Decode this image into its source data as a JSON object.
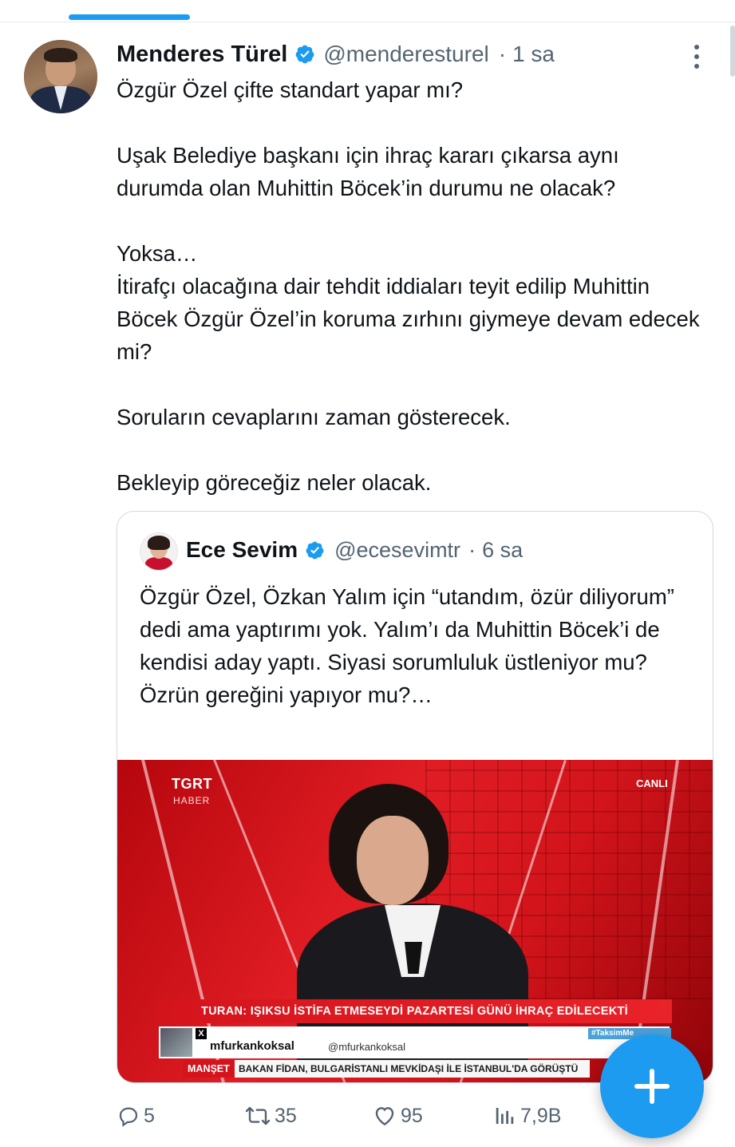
{
  "tweet": {
    "author_name": "Menderes Türel",
    "handle": "@menderesturel",
    "time": "1 sa",
    "paragraphs": [
      "Özgür Özel çifte standart yapar mı?",
      "Uşak Belediye başkanı için ihraç kararı çıkarsa aynı durumda olan Muhittin Böcek’in durumu ne olacak?",
      "Yoksa…\nİtirafçı olacağına dair tehdit iddiaları teyit edilip Muhittin Böcek Özgür Özel’in koruma zırhını giymeye devam edecek mi?",
      "Soruların cevaplarını zaman gösterecek.",
      "Bekleyip göreceğiz neler olacak."
    ]
  },
  "quote": {
    "author_name": "Ece Sevim",
    "handle": "@ecesevimtr",
    "time": "6 sa",
    "text": "Özgür Özel, Özkan Yalım için “utandım, özür diliyorum” dedi ama yaptırımı yok. Yalım’ı da Muhittin Böcek’i de kendisi aday yaptı. Siyasi sorumluluk üstleniyor mu? Özrün gereğini yapıyor mu?…",
    "media": {
      "channel": "TGRT",
      "channel_sub": "HABER",
      "live": "CANLI",
      "ticker": "TURAN: IŞIKSU İSTİFA ETMESEYDİ PAZARTESİ GÜNÜ İHRAÇ EDİLECEKTİ",
      "social_name": "mfurkankoksal",
      "social_handle": "@mfurkankoksal",
      "social_x": "X",
      "hashtag": "#TaksimMe",
      "manset_label": "MANŞET",
      "manset_text": "BAKAN FİDAN, BULGARİSTANLI MEVKİDAŞI İLE İSTANBUL'DA GÖRÜŞTÜ"
    }
  },
  "actions": {
    "replies": "5",
    "retweets": "35",
    "likes": "95",
    "views": "7,9B"
  },
  "icons": {
    "verified": "verified-badge-icon",
    "more": "more-vertical-icon",
    "reply": "reply-icon",
    "retweet": "retweet-icon",
    "like": "heart-icon",
    "views": "views-icon",
    "compose": "plus-icon"
  },
  "colors": {
    "accent": "#1d9bf0",
    "text": "#0f1419",
    "secondary": "#536471",
    "border": "#cfd9de"
  }
}
